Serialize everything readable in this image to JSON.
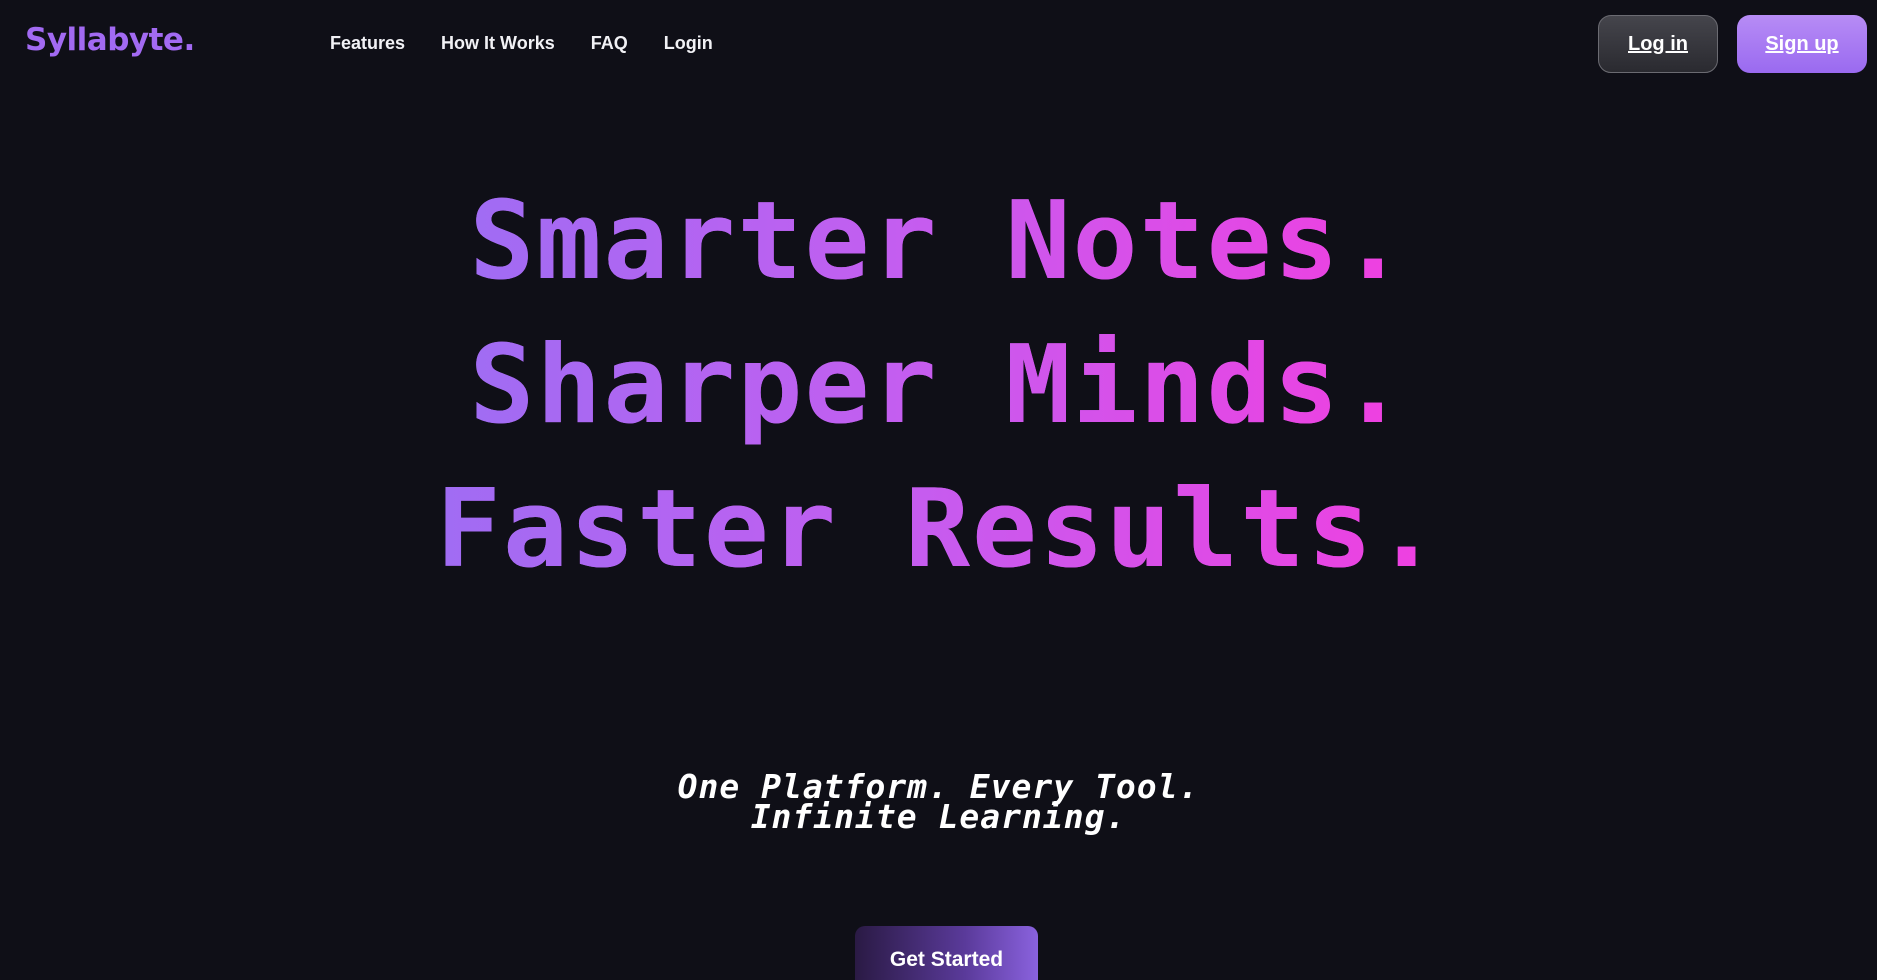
{
  "brand": {
    "name": "Syllabyte",
    "dot": "."
  },
  "nav": {
    "items": [
      {
        "label": "Features"
      },
      {
        "label": "How It Works"
      },
      {
        "label": "FAQ"
      },
      {
        "label": "Login"
      }
    ]
  },
  "auth": {
    "login_label": "Log in",
    "signup_label": "Sign up"
  },
  "hero": {
    "lines": [
      "Smarter Notes.",
      "Sharper Minds.",
      "Faster Results."
    ],
    "tagline_lines": [
      "One Platform. Every Tool.",
      "Infinite Learning."
    ],
    "cta_label": "Get Started"
  },
  "colors": {
    "background": "#0f0f17",
    "brand_purple": "#a26af2",
    "gradient_start": "#a06cf3",
    "gradient_end": "#f03fe0"
  }
}
